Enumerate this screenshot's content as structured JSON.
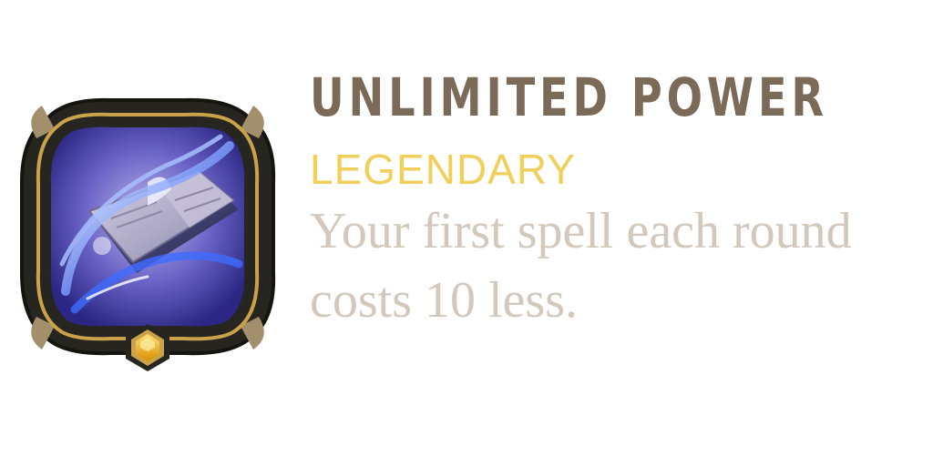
{
  "augment": {
    "title": "UNLIMITED POWER",
    "rarity": "LEGENDARY",
    "description": "Your first spell each round costs 10 less.",
    "icon": "spellbook-icon",
    "gem_icon": "hexagon-gem-icon"
  },
  "colors": {
    "title": "#7b6a58",
    "rarity": "#f0cf5a",
    "description": "#d2c8bc",
    "frame": "#2b2a24",
    "frame_trim": "#c9a24a",
    "magic_blue": "#3f6bff",
    "gem": "#f3b619"
  }
}
